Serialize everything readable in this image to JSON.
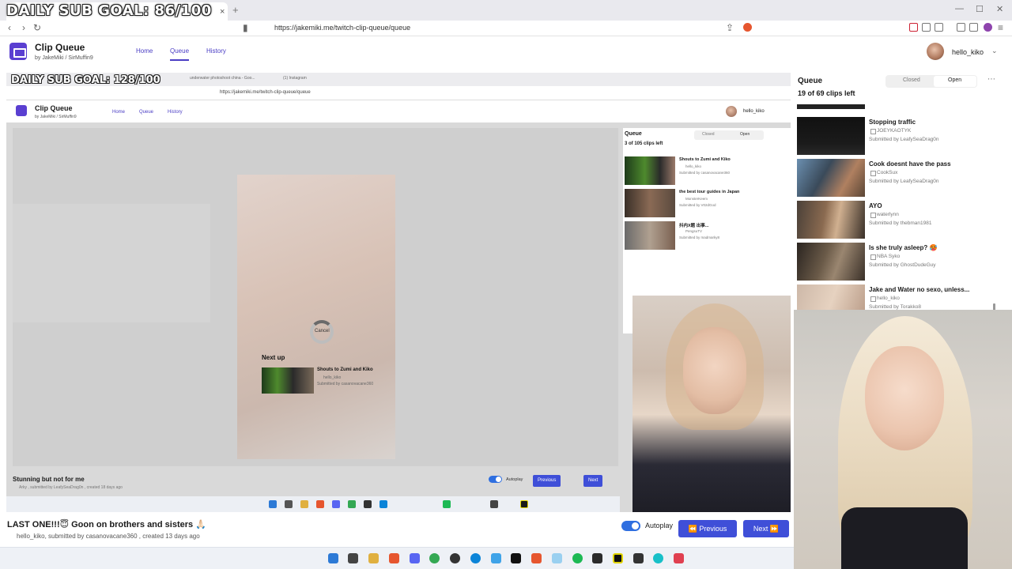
{
  "overlay": {
    "sub_goal": "DAILY SUB GOAL: 86/100"
  },
  "browser": {
    "url": "https://jakemiki.me/twitch-clip-queue/queue",
    "tab_close": "×",
    "tab_new": "+",
    "win_min": "—",
    "win_max": "☐",
    "win_close": "✕"
  },
  "site": {
    "brand": "Clip Queue",
    "byline": "by  JakeMiki / SirMuffin9",
    "nav": {
      "home": "Home",
      "queue": "Queue",
      "history": "History"
    },
    "user": "hello_kiko"
  },
  "nested": {
    "sub_goal": "DAILY SUB GOAL: 128/100",
    "tabs": [
      "underwater photoshoot china - Goo...",
      "(1) Instagram"
    ],
    "url": "https://jakemiki.me/twitch-clip-queue/queue",
    "brand": "Clip Queue",
    "byline": "by  JakeMiki / SirMuffin9",
    "nav": {
      "home": "Home",
      "queue": "Queue",
      "history": "History"
    },
    "user": "hello_kiko",
    "cancel": "Cancel",
    "next_up": "Next up",
    "next_clip": {
      "title": "Shouts to Zumi and Kiko",
      "author": "hello_kiko",
      "submitted": "Submitted by casanovacane360"
    },
    "queue": {
      "title": "Queue",
      "closed": "Closed",
      "open": "Open",
      "count": "3 of 105 clips left",
      "items": [
        {
          "title": "Shouts to Zumi and Kiko",
          "author": "hello_kiko",
          "submitted": "Submitted by casanovacane360"
        },
        {
          "title": "the best tour guides in Japan",
          "author": "MonsterKeem",
          "submitted": "Submitted by V02dGod"
        },
        {
          "title": "抖内X题 出事...",
          "author": "PengsuTV",
          "submitted": "Submitted by madmarky8"
        }
      ]
    },
    "clip": {
      "title": "Stunning but not for me",
      "meta": "Arky , submitted by LeafySeaDrag0n , created 18 days ago"
    },
    "autoplay": "Autoplay",
    "previous": "Previous",
    "next": "Next"
  },
  "queue": {
    "title": "Queue",
    "closed": "Closed",
    "open": "Open",
    "more": "⋯",
    "count": "19 of 69 clips left",
    "items": [
      {
        "title": "Stopping traffic",
        "author": "JOEYKAOTYK",
        "submitted": "Submitted by LeafySeaDrag0n"
      },
      {
        "title": "Cook doesnt have the pass",
        "author": "CookSux",
        "submitted": "Submitted by LeafySeaDrag0n"
      },
      {
        "title": "AYO",
        "author": "waterlynn",
        "submitted": "Submitted by thebman1981"
      },
      {
        "title": "Is she truly asleep? 🥵",
        "author": "NBA Syko",
        "submitted": "Submitted by GhostDudeGuy"
      },
      {
        "title": "Jake and Water no sexo, unless...",
        "author": "hello_kiko",
        "submitted": "Submitted by Torakko8"
      }
    ]
  },
  "clip": {
    "title": "LAST ONE!!!😇 Goon on brothers and sisters 🙏🏻",
    "author": "hello_kiko",
    "meta": ", submitted by casanovacane360 , created 13 days ago"
  },
  "controls": {
    "autoplay": "Autoplay",
    "previous": "⏪ Previous",
    "next": "Next ⏩",
    "autoplay_on": true
  },
  "taskbar_icons": [
    "windows-icon",
    "explorer-icon",
    "folder-icon",
    "brave-icon",
    "discord-icon",
    "chrome-icon",
    "obs-icon",
    "edge-icon",
    "vscode-icon",
    "capcut-icon",
    "brave-nightly-icon",
    "notepad-icon",
    "spotify-icon",
    "xbox-icon",
    "streamlabs-icon",
    "terminal-icon",
    "app-icon",
    "app2-icon"
  ],
  "colors": {
    "accent": "#3f4fd8",
    "brand": "#5a3fd1"
  }
}
